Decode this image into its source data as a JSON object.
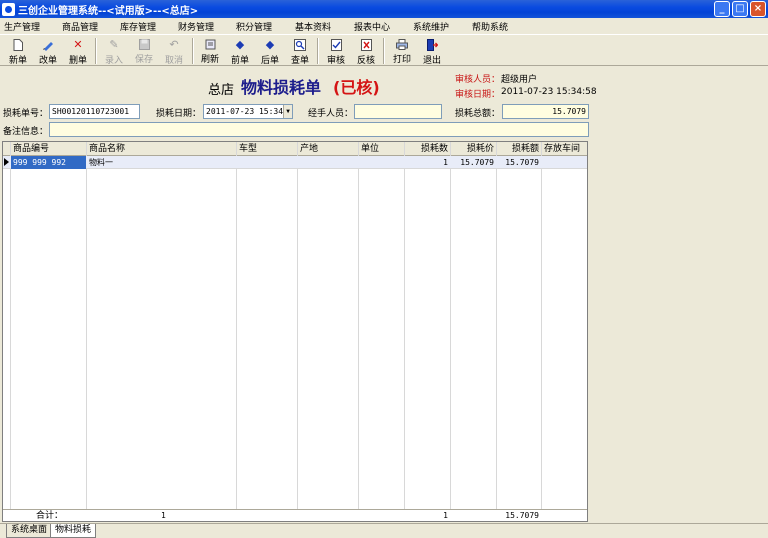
{
  "window": {
    "title": "三创企业管理系统--<试用版>--<总店>",
    "minimize": "_",
    "maximize": "□",
    "close": "×"
  },
  "menu": [
    "生产管理",
    "商品管理",
    "库存管理",
    "财务管理",
    "积分管理",
    "基本资料",
    "报表中心",
    "系统维护",
    "帮助系统"
  ],
  "toolbar": {
    "new": "新单",
    "edit": "改单",
    "delete": "删单",
    "enter": "录入",
    "save": "保存",
    "cancel": "取消",
    "refresh": "刷新",
    "prev": "前单",
    "next": "后单",
    "search": "查单",
    "audit": "审核",
    "unaudit": "反核",
    "print": "打印",
    "exit": "退出"
  },
  "header": {
    "branch": "总店",
    "doc_title": "物料损耗单",
    "status": "(已核)",
    "auditor_label": "审核人员：",
    "auditor_value": "超级用户",
    "audit_date_label": "审核日期：",
    "audit_date_value": "2011-07-23 15:34:58"
  },
  "form": {
    "doc_no_label": "损耗单号：",
    "doc_no_value": "SH00120110723001",
    "date_label": "损耗日期：",
    "date_value": "2011-07-23 15:34:",
    "handler_label": "经手人员：",
    "handler_value": "",
    "total_label": "损耗总额：",
    "total_value": "15.7079",
    "remark_label": "备注信息：",
    "remark_value": ""
  },
  "grid": {
    "columns": [
      "商品编号",
      "商品名称",
      "车型",
      "产地",
      "单位",
      "损耗数",
      "损耗价",
      "损耗额",
      "存放车间"
    ],
    "rows": [
      {
        "code": "999 999 992",
        "name": "物料一",
        "model": "",
        "origin": "",
        "unit": "",
        "qty": "1",
        "price": "15.7079",
        "amount": "15.7079",
        "workshop": ""
      }
    ],
    "footer": {
      "label": "合计：",
      "name_count": "1",
      "qty_total": "1",
      "amount_total": "15.7079"
    }
  },
  "tabs": [
    "系统桌面",
    "物料损耗"
  ]
}
